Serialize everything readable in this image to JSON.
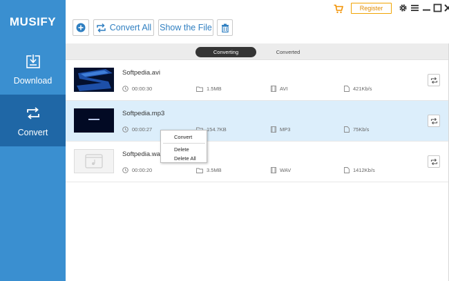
{
  "app": {
    "name": "MUSIFY"
  },
  "sidebar": {
    "items": [
      {
        "label": "Download",
        "icon": "download-icon",
        "active": false
      },
      {
        "label": "Convert",
        "icon": "convert-icon",
        "active": true
      }
    ]
  },
  "toolbar": {
    "add_icon": "add-icon",
    "convert_all_label": "Convert All",
    "show_file_label": "Show the File",
    "delete_icon": "trash-icon"
  },
  "titlebar": {
    "cart_icon": "cart-icon",
    "register_label": "Register",
    "icons": [
      "gear-icon",
      "menu-icon",
      "minimize-icon",
      "maximize-icon",
      "close-icon"
    ]
  },
  "tabs": [
    {
      "label": "Converting",
      "active": true
    },
    {
      "label": "Converted",
      "active": false
    }
  ],
  "files": [
    {
      "name": "Softpedia.avi",
      "duration": "00:00:30",
      "size": "1.5MB",
      "format": "AVI",
      "bitrate": "421Kb/s",
      "selected": false,
      "thumbnail": "video-frame"
    },
    {
      "name": "Softpedia.mp3",
      "duration": "00:00:27",
      "size": "154.7KB",
      "format": "MP3",
      "bitrate": "75Kb/s",
      "selected": true,
      "thumbnail": "video-frame"
    },
    {
      "name": "Softpedia.wav",
      "duration": "00:00:20",
      "size": "3.5MB",
      "format": "WAV",
      "bitrate": "1412Kb/s",
      "selected": false,
      "thumbnail": "audio-placeholder"
    }
  ],
  "context_menu": {
    "items": [
      "Convert",
      "Delete",
      "Delete All"
    ]
  },
  "colors": {
    "sidebar": "#3a8fd0",
    "sidebar_active": "#1f67a6",
    "accent": "#2f7fc1",
    "register": "#f0a300",
    "selected_row": "#dceefb"
  }
}
